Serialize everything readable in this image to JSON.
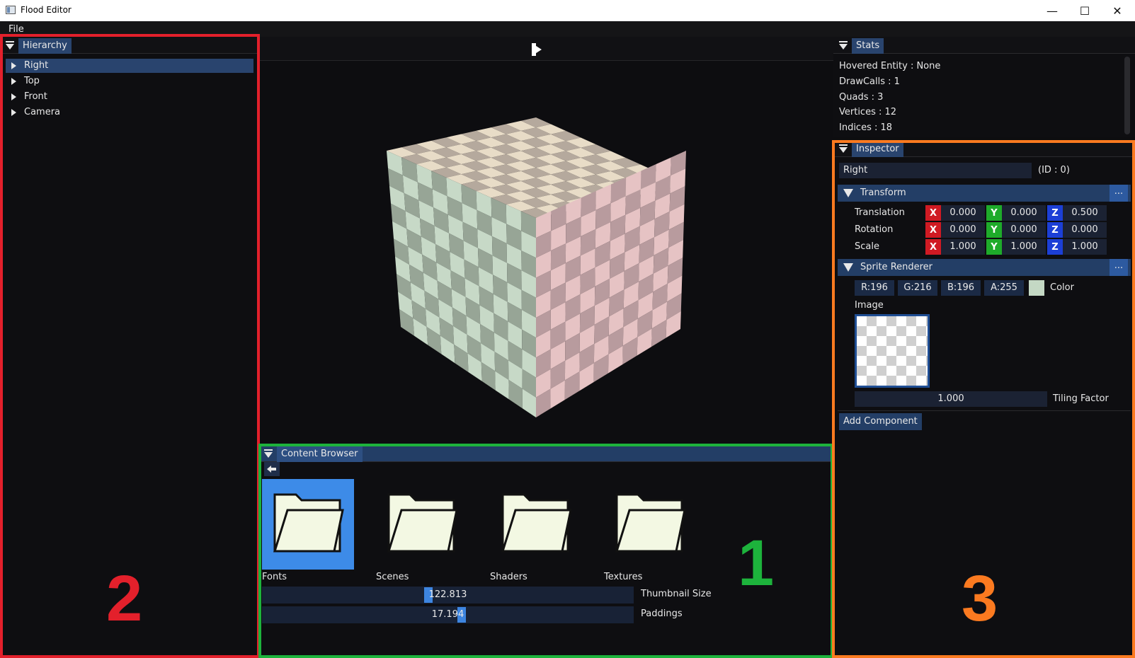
{
  "window": {
    "title": "Flood Editor",
    "minimize": "—",
    "maximize": "☐",
    "close": "✕"
  },
  "menu": {
    "file": "File"
  },
  "hierarchy": {
    "title": "Hierarchy",
    "items": [
      {
        "label": "Right",
        "selected": true
      },
      {
        "label": "Top"
      },
      {
        "label": "Front"
      },
      {
        "label": "Camera"
      }
    ]
  },
  "viewport": {
    "play_icon": "play-icon"
  },
  "content_browser": {
    "title": "Content Browser",
    "folders": [
      {
        "label": "Fonts",
        "selected": true
      },
      {
        "label": "Scenes"
      },
      {
        "label": "Shaders"
      },
      {
        "label": "Textures"
      }
    ],
    "sliders": [
      {
        "label": "Thumbnail Size",
        "value": "122.813",
        "fraction": 0.447
      },
      {
        "label": "Paddings",
        "value": "17.194",
        "fraction": 0.537
      }
    ]
  },
  "stats": {
    "title": "Stats",
    "lines": [
      "Hovered Entity : None",
      "DrawCalls : 1",
      "Quads : 3",
      "Vertices : 12",
      "Indices : 18"
    ]
  },
  "inspector": {
    "title": "Inspector",
    "entity_name": "Right",
    "entity_id": "(ID : 0)",
    "transform": {
      "title": "Transform",
      "more": "...",
      "rows": [
        {
          "label": "Translation",
          "x": "0.000",
          "y": "0.000",
          "z": "0.500"
        },
        {
          "label": "Rotation",
          "x": "0.000",
          "y": "0.000",
          "z": "0.000"
        },
        {
          "label": "Scale",
          "x": "1.000",
          "y": "1.000",
          "z": "1.000"
        }
      ],
      "axis_x": "X",
      "axis_y": "Y",
      "axis_z": "Z"
    },
    "sprite": {
      "title": "Sprite Renderer",
      "more": "...",
      "r": "R:196",
      "g": "G:216",
      "b": "B:196",
      "a": "A:255",
      "color_label": "Color",
      "swatch": "#c4d8c4",
      "image_label": "Image",
      "tiling_value": "1.000",
      "tiling_label": "Tiling Factor"
    },
    "add_component": "Add Component"
  },
  "annotations": [
    {
      "number": "1",
      "color": "#1db33c"
    },
    {
      "number": "2",
      "color": "#e3202b"
    },
    {
      "number": "3",
      "color": "#fb7a20"
    }
  ]
}
